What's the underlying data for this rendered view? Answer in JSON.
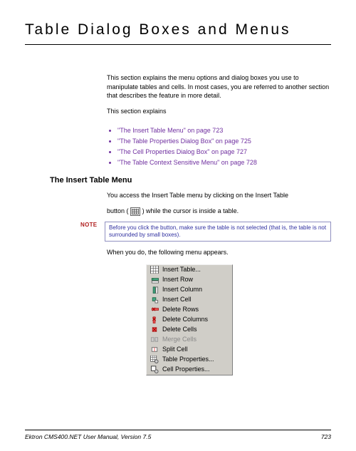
{
  "title": "Table Dialog Boxes and Menus",
  "intro": "This section explains the menu options and dialog boxes you use to manipulate tables and cells. In most cases, you are referred to another section that describes the feature in more detail.",
  "section_explains_label": "This section explains",
  "links": [
    "\"The Insert Table Menu\" on page 723",
    "\"The Table Properties Dialog Box\" on page 725",
    "\"The Cell Properties Dialog Box\" on page 727",
    "\"The Table Context Sensitive Menu\" on page 728"
  ],
  "subheading": "The Insert Table Menu",
  "access_text_1": "You access the Insert Table menu by clicking on the Insert Table",
  "access_text_2_pre": "button (",
  "access_text_2_post": ") while the cursor is inside a table.",
  "note_label": "NOTE",
  "note_text": "Before you click the button, make sure the table is not selected (that is, the table is not surrounded by small boxes).",
  "when_text": "When you do, the following menu appears.",
  "menu_items": [
    {
      "label": "Insert Table...",
      "disabled": false,
      "icon": "table-grid"
    },
    {
      "label": "Insert Row",
      "disabled": false,
      "icon": "insert-row"
    },
    {
      "label": "Insert Column",
      "disabled": false,
      "icon": "insert-col"
    },
    {
      "label": "Insert Cell",
      "disabled": false,
      "icon": "insert-cell"
    },
    {
      "label": "Delete Rows",
      "disabled": false,
      "icon": "delete-row"
    },
    {
      "label": "Delete Columns",
      "disabled": false,
      "icon": "delete-col"
    },
    {
      "label": "Delete Cells",
      "disabled": false,
      "icon": "delete-cell"
    },
    {
      "label": "Merge Cells",
      "disabled": true,
      "icon": "merge"
    },
    {
      "label": "Split Cell",
      "disabled": false,
      "icon": "split"
    },
    {
      "label": "Table Properties...",
      "disabled": false,
      "icon": "table-prop"
    },
    {
      "label": "Cell Properties...",
      "disabled": false,
      "icon": "cell-prop"
    }
  ],
  "footer_left": "Ektron CMS400.NET User Manual, Version 7.5",
  "footer_right": "723"
}
